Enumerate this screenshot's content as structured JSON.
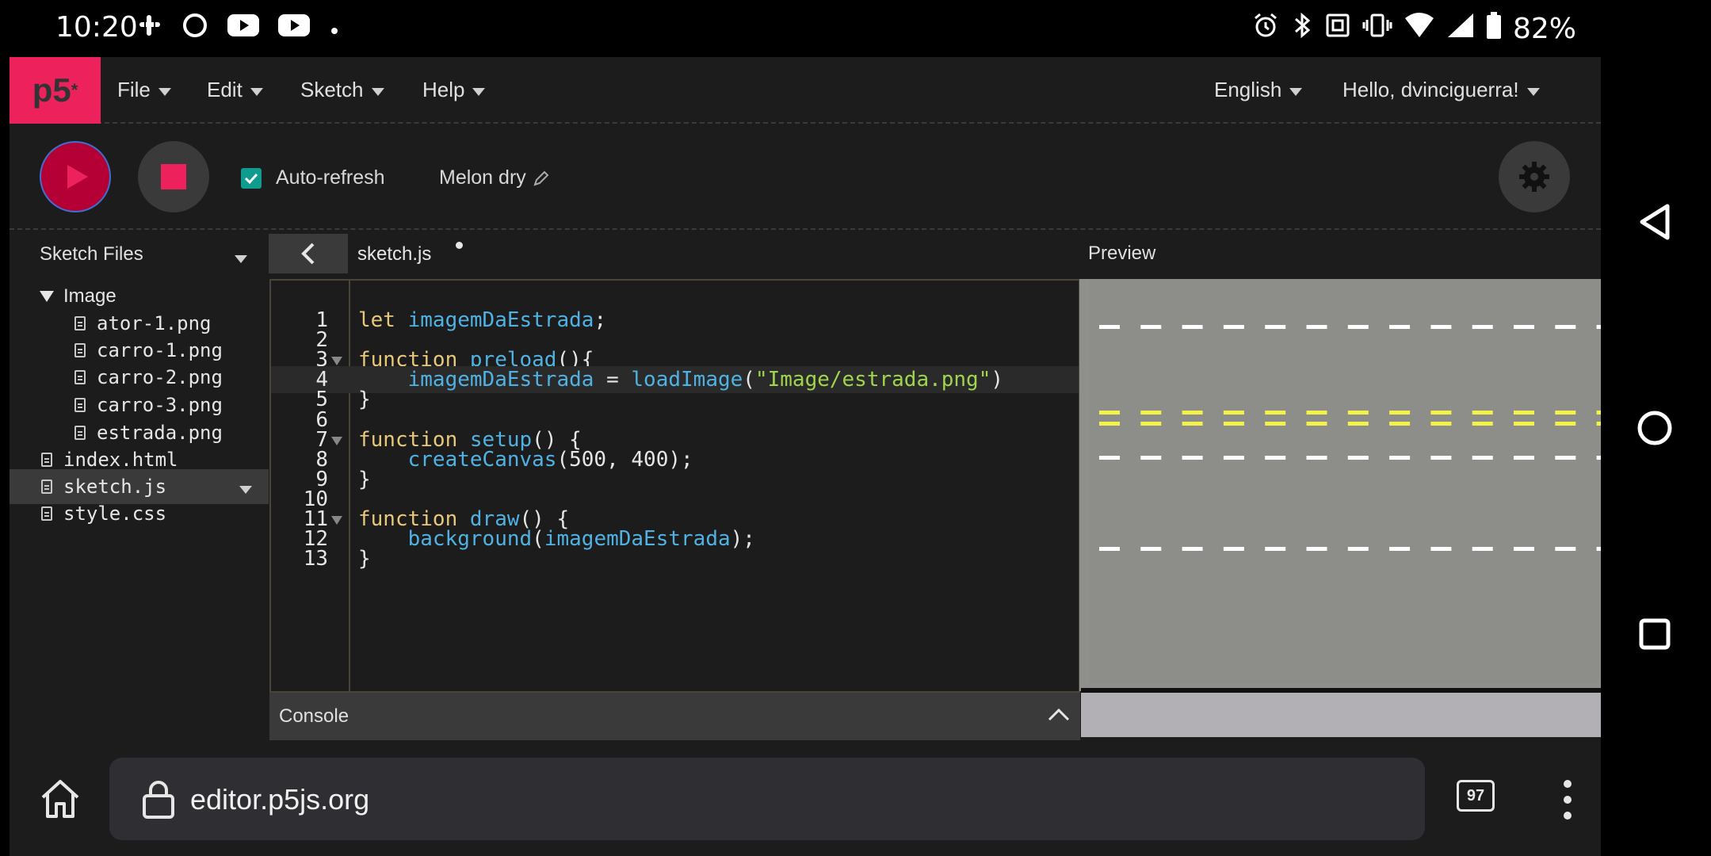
{
  "status_bar": {
    "time": "10:20",
    "battery": "82%"
  },
  "menu": {
    "logo": "p5",
    "logo_sup": "*",
    "file": "File",
    "edit": "Edit",
    "sketch": "Sketch",
    "help": "Help",
    "language": "English",
    "user": "Hello, dvinciguerra!"
  },
  "toolbar": {
    "auto_refresh_label": "Auto-refresh",
    "auto_refresh_checked": true,
    "sketch_name": "Melon dry"
  },
  "sidebar": {
    "title": "Sketch Files",
    "folder": "Image",
    "folder_files": [
      "ator-1.png",
      "carro-1.png",
      "carro-2.png",
      "carro-3.png",
      "estrada.png"
    ],
    "root_files": [
      "index.html",
      "sketch.js",
      "style.css"
    ],
    "selected_file": "sketch.js"
  },
  "editor": {
    "tab_name": "sketch.js",
    "active_line": 4,
    "lines": [
      {
        "n": "1",
        "fold": false
      },
      {
        "n": "2",
        "fold": false
      },
      {
        "n": "3",
        "fold": true
      },
      {
        "n": "4",
        "fold": false
      },
      {
        "n": "5",
        "fold": false
      },
      {
        "n": "6",
        "fold": false
      },
      {
        "n": "7",
        "fold": true
      },
      {
        "n": "8",
        "fold": false
      },
      {
        "n": "9",
        "fold": false
      },
      {
        "n": "10",
        "fold": false
      },
      {
        "n": "11",
        "fold": true
      },
      {
        "n": "12",
        "fold": false
      },
      {
        "n": "13",
        "fold": false
      }
    ],
    "code": {
      "l1_kw": "let",
      "l1_var": "imagemDaEstrada",
      "l1_end": ";",
      "l3_kw": "function",
      "l3_fn": "preload",
      "l3_end": "(){",
      "l4_var": "imagemDaEstrada",
      "l4_eq": " = ",
      "l4_fn": "loadImage",
      "l4_open": "(",
      "l4_str": "\"Image/estrada.png\"",
      "l4_close": ")",
      "l5": "}",
      "l7_kw": "function",
      "l7_fn": "setup",
      "l7_end": "() {",
      "l8_fn": "createCanvas",
      "l8_args": "(500, 400);",
      "l9": "}",
      "l11_kw": "function",
      "l11_fn": "draw",
      "l11_end": "() {",
      "l12_fn": "background",
      "l12_open": "(",
      "l12_var": "imagemDaEstrada",
      "l12_close": ");",
      "l13": "}"
    }
  },
  "console": {
    "label": "Console"
  },
  "preview": {
    "label": "Preview",
    "road_color": "#8d8e8a",
    "lane_white": "#ffffff",
    "lane_yellow": "#f2f24a"
  },
  "browser": {
    "url": "editor.p5js.org",
    "tab_count": "97"
  },
  "colors": {
    "accent": "#ed225d",
    "teal": "#0f9b8e"
  }
}
